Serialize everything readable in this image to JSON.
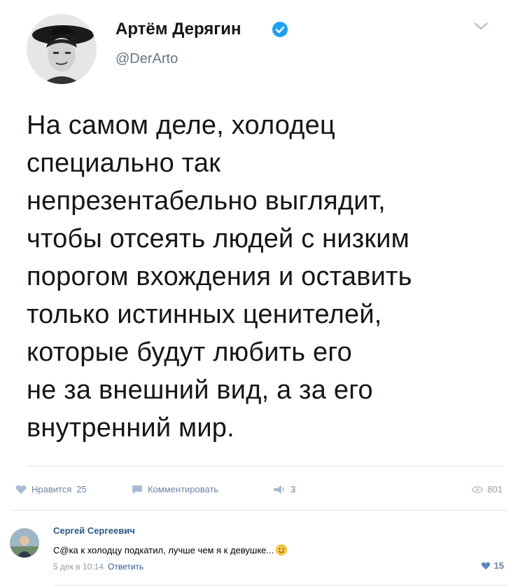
{
  "tweet": {
    "author_name": "Артём Дерягин",
    "handle": "@DerArto",
    "lines": [
      "На самом деле, холодец",
      "специально так",
      "непрезентабельно выглядит,",
      "чтобы отсеять людей с низким",
      "порогом вхождения и оставить",
      "только истинных ценителей,",
      "которые будут любить его",
      "не за внешний вид, а за его",
      "внутренний мир."
    ],
    "accent_color": "#1da1f2"
  },
  "actions": {
    "like_label": "Нравится",
    "like_count": "25",
    "comment_label": "Комментировать",
    "share_count": "3",
    "views_count": "801",
    "icons": [
      "heart-icon",
      "comment-icon",
      "share-icon",
      "eye-icon"
    ]
  },
  "comment": {
    "author": "Сергей Сергеевич",
    "text": "С@ка к холодцу подкатил, лучше чем я к девушке...",
    "date": "5 дек в 10:14",
    "reply_label": "Ответить",
    "like_count": "15",
    "link_color": "#2a5885"
  }
}
